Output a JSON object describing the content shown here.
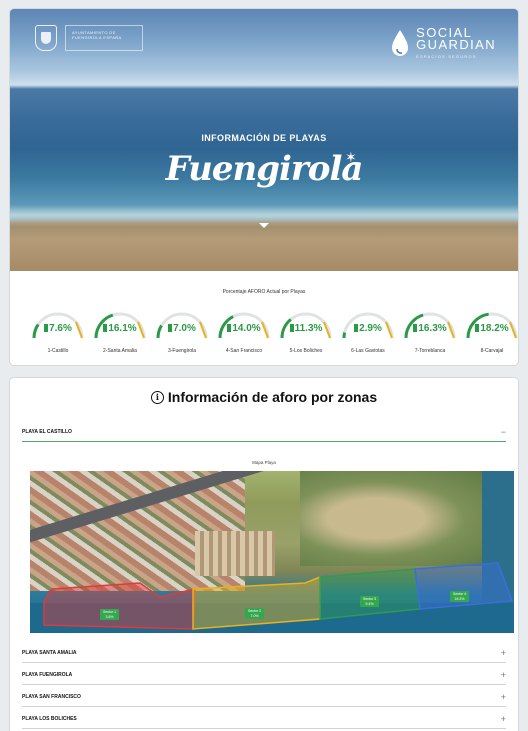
{
  "header": {
    "municipality_text": "AYUNTAMIENTO DE FUENGIROLA ESPAÑA",
    "brand_line1": "SOCIAL",
    "brand_line2": "GUARDIAN",
    "brand_tagline": "ESPACIOS SEGUROS",
    "kicker": "INFORMACIÓN DE PLAYAS",
    "script_title": "Fuengirola"
  },
  "gauges": {
    "caption": "Porcentaje AFORO Actual por Playas",
    "color": "#2a9a46",
    "items": [
      {
        "value": "7.6%",
        "label": "1-Castillo",
        "fraction": 0.076
      },
      {
        "value": "16.1%",
        "label": "2-Santa Amalia",
        "fraction": 0.161
      },
      {
        "value": "7.0%",
        "label": "3-Fuengirola",
        "fraction": 0.07
      },
      {
        "value": "14.0%",
        "label": "4-San Francisco",
        "fraction": 0.14
      },
      {
        "value": "11.3%",
        "label": "5-Los Boliches",
        "fraction": 0.113
      },
      {
        "value": "2.9%",
        "label": "6-Las Gaviotas",
        "fraction": 0.029
      },
      {
        "value": "16.3%",
        "label": "7-Torreblanca",
        "fraction": 0.163
      },
      {
        "value": "18.2%",
        "label": "8-Carvajal",
        "fraction": 0.182
      }
    ]
  },
  "zones": {
    "title": "Información de aforo por zonas",
    "expanded": {
      "name": "PLAYA EL CASTILLO",
      "sign": "−",
      "map_caption": "Mapa Playa"
    },
    "sectors": [
      {
        "label": "Sector 1",
        "value": "3.6%",
        "color": "#e03a3a"
      },
      {
        "label": "Sector 2",
        "value": "7.0%",
        "color": "#e8b21e"
      },
      {
        "label": "Sector 3",
        "value": "9.4%",
        "color": "#2f9a55"
      },
      {
        "label": "Sector 4",
        "value": "16.3%",
        "color": "#3a6fd8"
      }
    ],
    "collapsed": [
      {
        "name": "PLAYA SANTA AMALIA",
        "sign": "+"
      },
      {
        "name": "PLAYA FUENGIROLA",
        "sign": "+"
      },
      {
        "name": "PLAYA SAN FRANCISCO",
        "sign": "+"
      },
      {
        "name": "PLAYA LOS BOLICHES",
        "sign": "+"
      }
    ]
  }
}
